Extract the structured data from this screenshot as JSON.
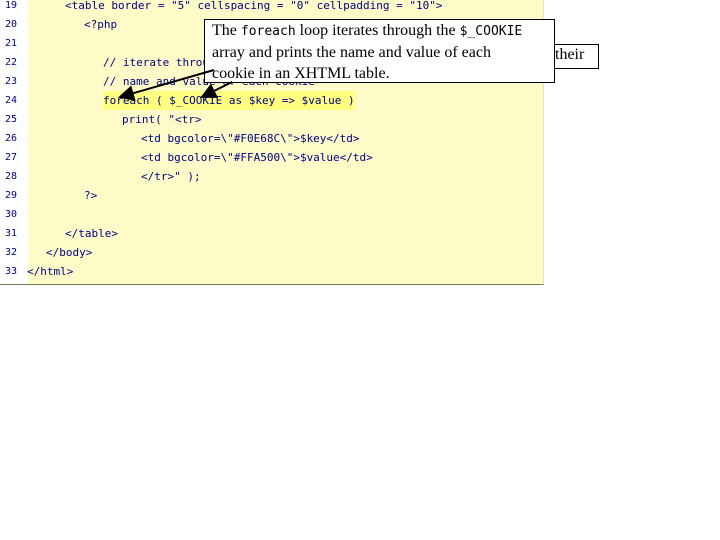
{
  "code_lines": [
    {
      "n": "19",
      "text": "<table border = \"5\" cellspacing = \"0\" cellpadding = \"10\">"
    },
    {
      "n": "20",
      "text": "<?php"
    },
    {
      "n": "21",
      "text": ""
    },
    {
      "n": "22",
      "text": "// iterate through"
    },
    {
      "n": "23",
      "text": "// name and value of each cookie"
    },
    {
      "n": "24",
      "text": "foreach ( $_COOKIE as $key => $value )"
    },
    {
      "n": "25",
      "text": "print( \"<tr>"
    },
    {
      "n": "26",
      "text": "<td bgcolor=\\\"#F0E68C\\\">$key</td>"
    },
    {
      "n": "27",
      "text": "<td bgcolor=\\\"#FFA500\\\">$value</td>"
    },
    {
      "n": "28",
      "text": "</tr>\" );"
    },
    {
      "n": "29",
      "text": "?>"
    },
    {
      "n": "30",
      "text": ""
    },
    {
      "n": "31",
      "text": "</table>"
    },
    {
      "n": "32",
      "text": "</body>"
    },
    {
      "n": "33",
      "text": "</html>"
    }
  ],
  "callout": {
    "part1": "The ",
    "code1": "foreach",
    "part2": " loop iterates through the ",
    "code2": "$_COOKIE",
    "line2": "array and prints the name and value of each",
    "line3": "cookie in an XHTML table.",
    "overflow_word": "their"
  },
  "colors": {
    "code_background": "#fdfcc8",
    "highlight": "#ffff80",
    "code_text": "#000080"
  }
}
